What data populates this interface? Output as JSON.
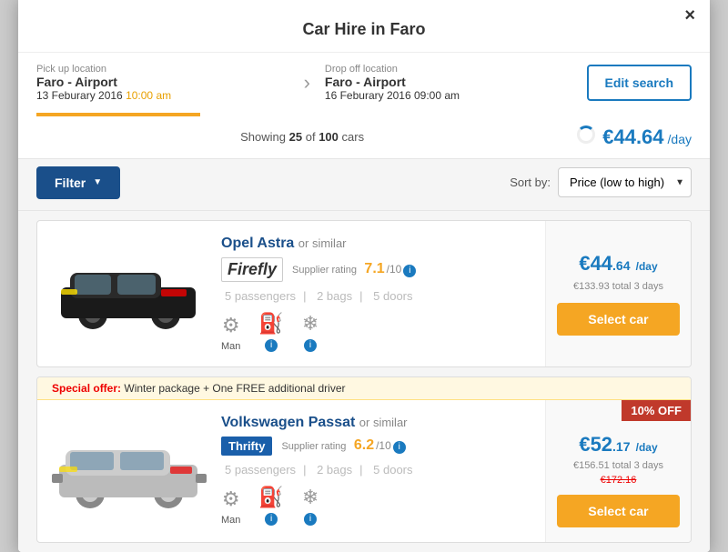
{
  "modal": {
    "title": "Car Hire in Faro",
    "close_label": "×"
  },
  "search": {
    "pickup_label": "Pick up location",
    "pickup_name": "Faro - Airport",
    "pickup_date": "13 Feburary 2016",
    "pickup_time": "10:00 am",
    "dropoff_label": "Drop off location",
    "dropoff_name": "Faro - Airport",
    "dropoff_date": "16 Feburary 2016",
    "dropoff_time": "09:00 am",
    "edit_btn": "Edit search"
  },
  "results": {
    "showing_text": "Showing",
    "count": "25",
    "of_text": "of",
    "total": "100",
    "cars_text": "cars",
    "min_price": "€44.64",
    "per_day": "/day"
  },
  "controls": {
    "filter_btn": "Filter",
    "sort_label": "Sort by:",
    "sort_value": "Price (low to high)"
  },
  "cars": [
    {
      "name": "Opel Astra",
      "or_similar": "or similar",
      "supplier": "Firefly",
      "supplier_type": "firefly",
      "rating_label": "Supplier rating",
      "rating": "7.1",
      "rating_out": "/10",
      "passengers": "5 passengers",
      "bags": "2 bags",
      "doors": "5 doors",
      "transmission": "Man",
      "price_whole": "€44",
      "price_cents": ".64",
      "price_day": "/day",
      "price_total": "€133.93 total 3 days",
      "select_btn": "Select car",
      "special_offer": null,
      "discount": null,
      "original_price": null
    },
    {
      "name": "Volkswagen Passat",
      "or_similar": "or similar",
      "supplier": "Thrifty",
      "supplier_type": "thrifty",
      "rating_label": "Supplier rating",
      "rating": "6.2",
      "rating_out": "/10",
      "passengers": "5 passengers",
      "bags": "2 bags",
      "doors": "5 doors",
      "transmission": "Man",
      "price_whole": "€52",
      "price_cents": ".17",
      "price_day": "/day",
      "price_total": "€156.51 total 3 days",
      "select_btn": "Select car",
      "special_offer": "Special offer:",
      "special_offer_text": "Winter package + One FREE additional driver",
      "discount": "10% OFF",
      "original_price": "€172.16"
    }
  ]
}
